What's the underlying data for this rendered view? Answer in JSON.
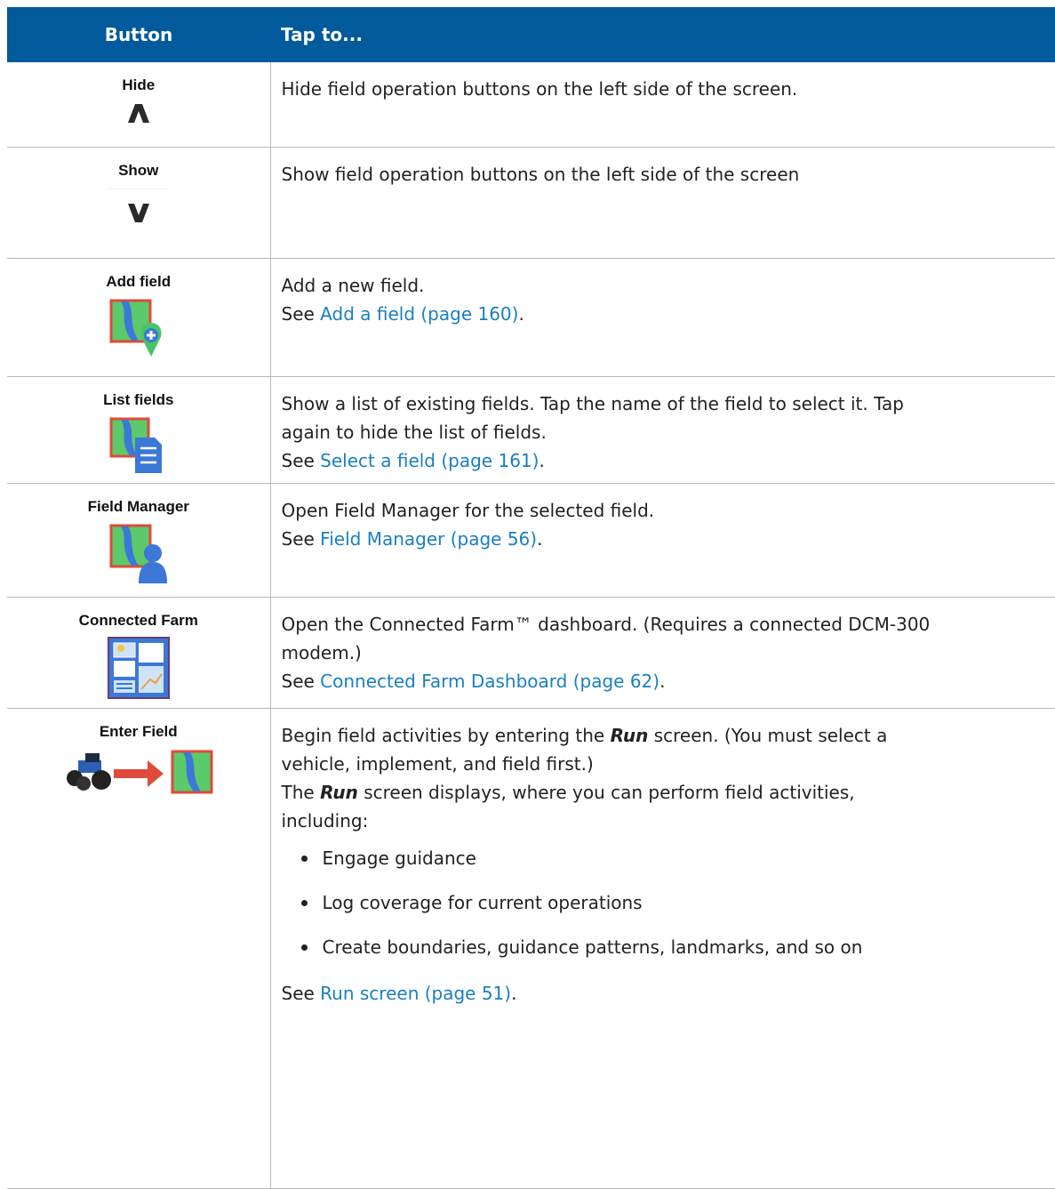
{
  "header": {
    "col_button": "Button",
    "col_tap": "Tap to..."
  },
  "colors": {
    "header_bg": "#005a9c",
    "link": "#1a7fc1",
    "field_green": "#5cc96b",
    "field_border": "#e04a3a",
    "map_blue": "#3b78d8"
  },
  "rows": [
    {
      "name": "Hide",
      "icon": "chevron-up-icon",
      "desc": [
        "Hide field operation buttons on the left side of the screen."
      ]
    },
    {
      "name": "Show",
      "icon": "chevron-down-icon",
      "desc": [
        "Show field operation buttons on the left side of the screen"
      ]
    },
    {
      "name": "Add field",
      "icon": "add-field-icon",
      "desc": [
        "Add a new field."
      ],
      "see": "See ",
      "link": "Add a field (page 160)",
      "after": "."
    },
    {
      "name": "List fields",
      "icon": "list-fields-icon",
      "desc": [
        "Show a list of existing fields. Tap the name of the field to select it. Tap",
        "again to hide the list of fields."
      ],
      "see": "See ",
      "link": "Select a field (page 161)",
      "after": "."
    },
    {
      "name": "Field Manager",
      "icon": "field-manager-icon",
      "desc": [
        "Open Field Manager for the selected field."
      ],
      "see": "See ",
      "link": "Field Manager (page 56)",
      "after": "."
    },
    {
      "name": "Connected Farm",
      "icon": "dashboard-icon",
      "desc": [
        "Open the Connected Farm™ dashboard. (Requires a connected DCM-300",
        "modem.)"
      ],
      "see": "See ",
      "link": "Connected Farm Dashboard (page 62)",
      "after": "."
    },
    {
      "name": "Enter Field",
      "icon": "enter-field-icon",
      "desc_a1": "Begin field activities by entering the ",
      "desc_a_em": "Run",
      "desc_a2": " screen. (You must select a",
      "desc_a3": "vehicle, implement, and field first.)",
      "desc_b1": "The ",
      "desc_b_em": "Run",
      "desc_b2": " screen displays, where you can perform field activities,",
      "desc_b3": "including:",
      "bullets": [
        "Engage guidance",
        "Log coverage for current operations",
        "Create boundaries, guidance patterns, landmarks, and so on"
      ],
      "see": "See ",
      "link": "Run screen (page 51)",
      "after": "."
    }
  ]
}
